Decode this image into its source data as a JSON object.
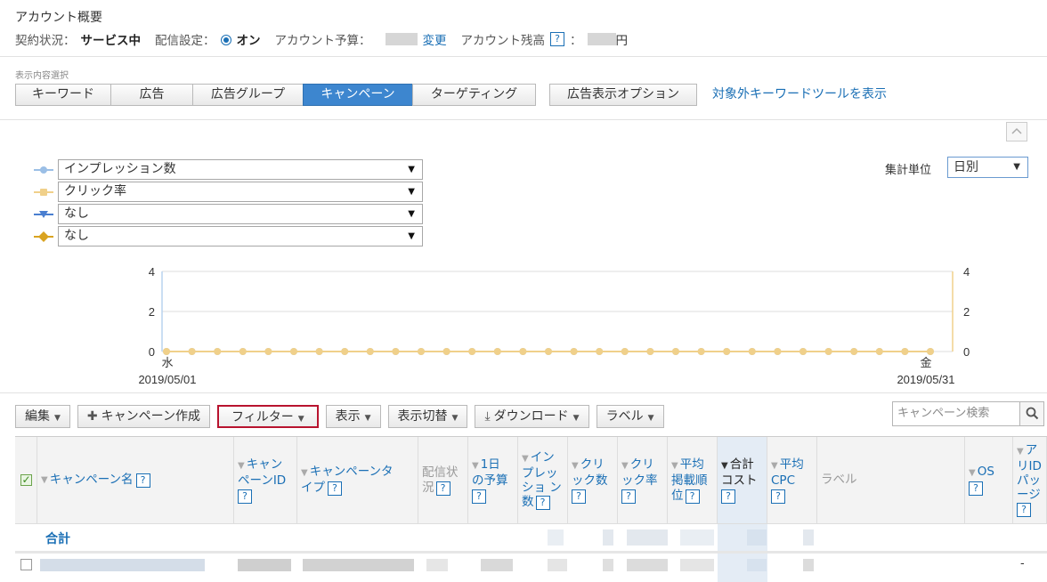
{
  "account": {
    "title": "アカウント概要",
    "contract_label": "契約状況：",
    "contract_value": "サービス中",
    "delivery_label": "配信設定：",
    "delivery_value": "オン",
    "budget_label": "アカウント予算：",
    "budget_change": "変更",
    "balance_label": "アカウント残高",
    "balance_colon": "：",
    "balance_unit": "円",
    "help": "?"
  },
  "view": {
    "label": "表示内容選択",
    "tabs": [
      {
        "label": "キーワード",
        "active": false
      },
      {
        "label": "広告",
        "active": false
      },
      {
        "label": "広告グループ",
        "active": false
      },
      {
        "label": "キャンペーン",
        "active": true
      },
      {
        "label": "ターゲティング",
        "active": false
      }
    ],
    "ad_options": "広告表示オプション",
    "excluded_link": "対象外キーワードツールを表示"
  },
  "graph": {
    "collapse": "^",
    "metrics": [
      {
        "label": "インプレッション数",
        "color": "#9bbfe6"
      },
      {
        "label": "クリック率",
        "color": "#f0d08a"
      },
      {
        "label": "なし",
        "color": "#4a7fd0"
      },
      {
        "label": "なし",
        "color": "#d9a320"
      }
    ],
    "aggregation_label": "集計単位",
    "aggregation_value": "日別"
  },
  "chart_data": {
    "type": "line",
    "left_axis_ticks": [
      "4",
      "2",
      "0"
    ],
    "right_axis_ticks": [
      "4",
      "2",
      "0"
    ],
    "ylim": [
      0,
      4
    ],
    "x_start_day": "水",
    "x_start_date": "2019/05/01",
    "x_end_day": "金",
    "x_end_date": "2019/05/31",
    "series": [
      {
        "values": [
          0,
          0,
          0,
          0,
          0,
          0,
          0,
          0,
          0,
          0,
          0,
          0,
          0,
          0,
          0,
          0,
          0,
          0,
          0,
          0,
          0,
          0,
          0,
          0,
          0,
          0,
          0,
          0,
          0,
          0,
          0
        ]
      },
      {
        "values": [
          0,
          0,
          0,
          0,
          0,
          0,
          0,
          0,
          0,
          0,
          0,
          0,
          0,
          0,
          0,
          0,
          0,
          0,
          0,
          0,
          0,
          0,
          0,
          0,
          0,
          0,
          0,
          0,
          0,
          0,
          0
        ]
      }
    ],
    "series_colors": [
      "#b9d2ef",
      "#f0d08a"
    ]
  },
  "toolbar": {
    "edit": "編集",
    "create_campaign": "キャンペーン作成",
    "filter": "フィルター",
    "display": "表示",
    "display_switch": "表示切替",
    "download": "ダウンロード",
    "label": "ラベル",
    "search_placeholder": "キャンペーン検索"
  },
  "table": {
    "columns": {
      "campaign_name": "キャンペーン名",
      "campaign_id_1": "キャン",
      "campaign_id_2": "ペーンID",
      "campaign_type_1": "キャンペーンタ",
      "campaign_type_2": "イプ",
      "delivery_1": "配信状",
      "delivery_2": "況",
      "daily_budget_1": "1日",
      "daily_budget_2": "の予算",
      "impressions_1": "イン",
      "impressions_2": "プレッ",
      "impressions_3": "ショ ン",
      "impressions_4": "数",
      "clicks_1": "クリ",
      "clicks_2": "ック数",
      "ctr_1": "クリ",
      "ctr_2": "ック率",
      "avg_pos_1": "平均",
      "avg_pos_2": "掲載順",
      "avg_pos_3": "位",
      "total_cost_1": "合計",
      "total_cost_2": "コスト",
      "avg_cpc_1": "平均",
      "avg_cpc_2": "CPC",
      "label": "ラベル",
      "os": "OS",
      "app_1": "ア",
      "app_2": "リID",
      "app_3": "パッ",
      "app_4": "ージ",
      "help": "?"
    },
    "totals_label": "合計",
    "row_last_value": "-"
  }
}
